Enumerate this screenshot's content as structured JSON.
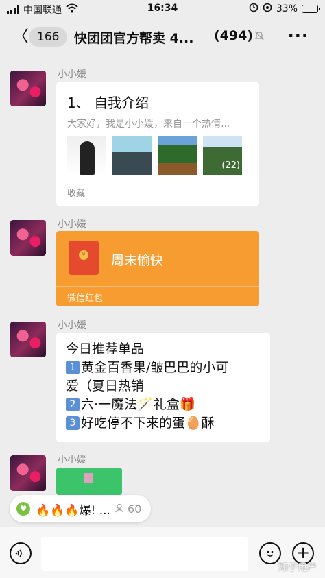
{
  "status_bar": {
    "carrier": "中国联通",
    "time": "16:34",
    "battery": "33%",
    "battery_level": 0.33
  },
  "nav": {
    "back_glyph": "〈",
    "unread_count": "166",
    "title": "快团团官方帮卖 4...",
    "member_count": "(494)",
    "more_glyph": "···"
  },
  "messages": [
    {
      "sender": "小小媛",
      "type": "article-card",
      "title": "1、 自我介绍",
      "summary": "大家好，我是小小媛，来自一个热情...",
      "image_count": "(22)",
      "footer": "收藏"
    },
    {
      "sender": "小小媛",
      "type": "red-packet",
      "title": "周末愉快",
      "footer": "微信红包"
    },
    {
      "sender": "小小媛",
      "type": "text",
      "lines": [
        "今日推荐单品",
        "黄金百香果/皱巴巴的小可",
        "爱（夏日热销",
        "六·一魔法🪄礼盒🎁",
        "好吃停不下来的蛋🥚酥"
      ],
      "keycaps": [
        "1",
        "2",
        "3"
      ]
    },
    {
      "sender": "小小媛",
      "type": "mini-card"
    }
  ],
  "pinned": {
    "text": "🔥🔥🔥爆! ...",
    "people": "60"
  },
  "watermark": "知乎用户",
  "icons": [
    "signal-icon",
    "wifi-icon",
    "alarm-icon",
    "battery-icon",
    "back-icon",
    "mute-icon",
    "more-icon",
    "voice-icon",
    "emoji-icon",
    "plus-icon",
    "person-icon"
  ]
}
